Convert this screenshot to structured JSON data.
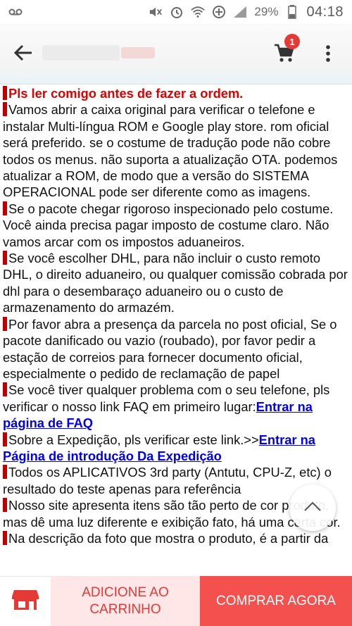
{
  "status_bar": {
    "battery_percent": "29%",
    "time": "04:18",
    "icons": [
      "voicemail-icon",
      "mute-icon",
      "alarm-icon",
      "wifi-icon",
      "data-saver-icon",
      "signal-icon",
      "battery-icon"
    ]
  },
  "app_bar": {
    "back_icon": "back-arrow-icon",
    "cart_icon": "cart-icon",
    "cart_count": "1",
    "more_icon": "more-vert-icon"
  },
  "content": {
    "p1": "Pls ler comigo antes de fazer a ordem.",
    "p2": "Vamos abrir a caixa original para verificar o telefone e instalar Multi-língua ROM e Google play store. rom oficial será preferido. se o costume de tradução pode não cobre todos os menus. não suporta a atualização OTA. podemos atualizar a ROM, de modo que a versão do SISTEMA OPERACIONAL pode ser diferente como as imagens.",
    "p3": "Se o pacote chegar rigoroso inspecionado pelo costume. Você ainda precisa pagar imposto de costume claro. Não vamos arcar com os impostos aduaneiros.",
    "p4": "Se você escolher DHL, para não incluir o custo remoto DHL, o direito aduaneiro, ou qualquer comissão cobrada por dhl para o desembaraço aduaneiro ou o custo de armazenamento do armazém.",
    "p5": "Por favor abra a presença da parcela no post oficial, Se o pacote danificado ou vazio (roubado), por favor pedir a estação de correios para fornecer documento oficial, especialmente o pedido de reclamação de papel",
    "p6_text": "Se você tiver qualquer problema com o seu telefone, pls verificar o nosso link FAQ em primeiro lugar:",
    "p6_link": "Entrar na página de FAQ",
    "p7_text": "Sobre a Expedição, pls verificar este link.>>",
    "p7_link": "Entrar na Página de introdução Da Expedição",
    "p8": "Todos os APLICATIVOS 3rd party (Antutu, CPU-Z, etc) o resultado do teste apenas para referência",
    "p9": "Nosso site apresenta itens são tão perto de cor produto, mas dê uma luz diferente e exibição fato, há uma certa cor.",
    "p10": "Na descrição da foto que mostra o produto, é a partir da"
  },
  "bottom_bar": {
    "store_icon": "store-icon",
    "add_to_cart": "ADICIONE AO CARRINHO",
    "buy_now": "COMPRAR AGORA"
  },
  "scroll_top_icon": "chevron-up-icon",
  "colors": {
    "accent_red": "#e53935",
    "buy_now_bg": "#f4504e",
    "add_cart_bg": "#ffe7e7",
    "heading_red": "#e00000",
    "link_blue": "#0000ee"
  }
}
